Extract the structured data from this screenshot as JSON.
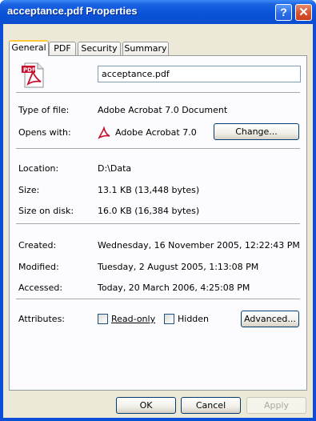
{
  "window": {
    "title": "acceptance.pdf Properties"
  },
  "titlebar_buttons": {
    "help": "?",
    "close": "✕"
  },
  "tabs": [
    {
      "label": "General",
      "active": true
    },
    {
      "label": "PDF",
      "active": false
    },
    {
      "label": "Security",
      "active": false
    },
    {
      "label": "Summary",
      "active": false
    }
  ],
  "general": {
    "file_icon": "pdf-file-icon",
    "file_name": "acceptance.pdf",
    "type_label": "Type of file:",
    "type_value": "Adobe Acrobat 7.0 Document",
    "opens_label": "Opens with:",
    "opens_value": "Adobe Acrobat 7.0",
    "change_button": "Change...",
    "location_label": "Location:",
    "location_value": "D:\\Data",
    "size_label": "Size:",
    "size_value": "13.1 KB (13,448 bytes)",
    "disk_label": "Size on disk:",
    "disk_value": "16.0 KB (16,384 bytes)",
    "created_label": "Created:",
    "created_value": "Wednesday, 16 November 2005, 12:22:43 PM",
    "modified_label": "Modified:",
    "modified_value": "Tuesday, 2 August 2005, 1:13:08 PM",
    "accessed_label": "Accessed:",
    "accessed_value": "Today, 20 March 2006, 4:25:08 PM",
    "attributes_label": "Attributes:",
    "readonly_label": "Read-only",
    "readonly_checked": false,
    "hidden_label": "Hidden",
    "hidden_checked": false,
    "advanced_button": "Advanced..."
  },
  "footer": {
    "ok": "OK",
    "cancel": "Cancel",
    "apply": "Apply"
  },
  "colors": {
    "title_bar": "#0b4fd8",
    "dialog_face": "#ece9d8",
    "close_button": "#d7522f",
    "active_tab_accent": "#ffc83c"
  }
}
